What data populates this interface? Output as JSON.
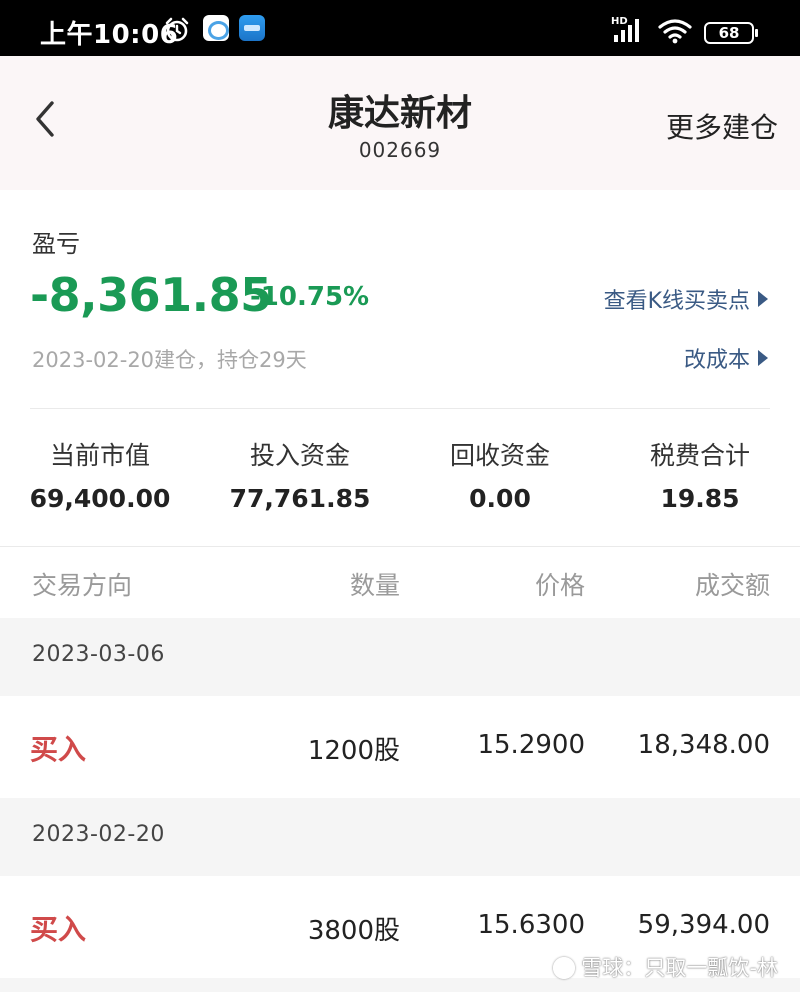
{
  "status_bar": {
    "time": "上午10:06",
    "network": "HD",
    "battery": "68"
  },
  "header": {
    "stock_name": "康达新材",
    "stock_code": "002669",
    "more_label": "更多建仓"
  },
  "pnl": {
    "label": "盈亏",
    "amount": "-8,361.85",
    "percent": "-10.75%",
    "kline_link": "查看K线买卖点",
    "build_info": "2023-02-20建仓，持仓29天",
    "cost_link": "改成本",
    "color": "#1a9a55"
  },
  "stats": [
    {
      "label": "当前市值",
      "value": "69,400.00"
    },
    {
      "label": "投入资金",
      "value": "77,761.85"
    },
    {
      "label": "回收资金",
      "value": "0.00"
    },
    {
      "label": "税费合计",
      "value": "19.85"
    }
  ],
  "table": {
    "headers": [
      "交易方向",
      "数量",
      "价格",
      "成交额"
    ],
    "groups": [
      {
        "date": "2023-03-06",
        "rows": [
          {
            "direction": "买入",
            "quantity": "1200股",
            "price": "15.2900",
            "amount": "18,348.00"
          }
        ]
      },
      {
        "date": "2023-02-20",
        "rows": [
          {
            "direction": "买入",
            "quantity": "3800股",
            "price": "15.6300",
            "amount": "59,394.00"
          }
        ]
      }
    ]
  },
  "watermark": "雪球：只取一瓢饮-林",
  "colors": {
    "buy": "#d04a4a",
    "link": "#3a5a84",
    "header_bg": "#fbf6f7"
  }
}
